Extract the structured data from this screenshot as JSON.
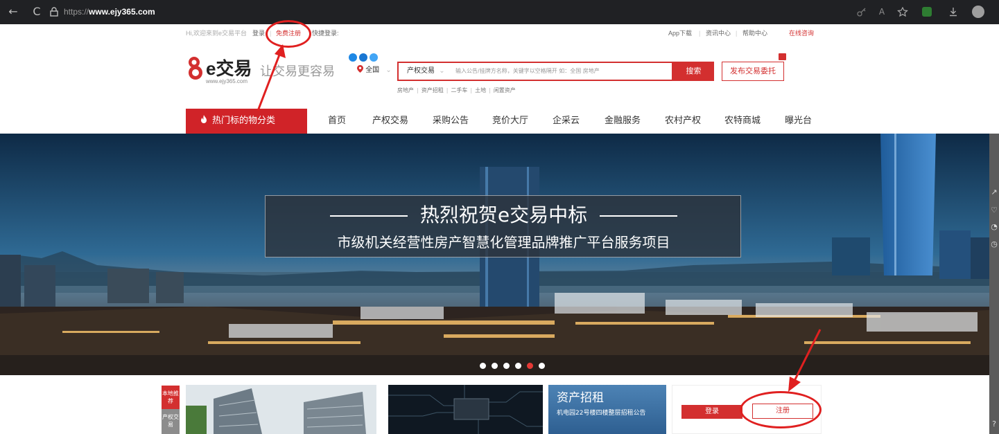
{
  "browser": {
    "url_prefix": "https://",
    "url_domain": "www.ejy365.com",
    "back_glyph": "←",
    "refresh_glyph": "C"
  },
  "topbar": {
    "welcome": "Hi,欢迎来到e交易平台",
    "login": "登录",
    "register": "免费注册",
    "quick_login": "快捷登录:",
    "app_download": "App下载",
    "news_center": "资讯中心",
    "help_center": "帮助中心",
    "online_consult": "在线咨询"
  },
  "header": {
    "logo_text": "e交易",
    "logo_url": "www.ejy365.com",
    "slogan": "让交易更容易",
    "region": "全国",
    "search_category": "产权交易",
    "search_placeholder": "输入公告/挂牌方名称，关键字以空格隔开 如：全国 房地产",
    "search_button": "搜索",
    "publish_button": "发布交易委托",
    "hotwords": [
      "房地产",
      "资产招租",
      "二手车",
      "土地",
      "闲置资产"
    ]
  },
  "nav": {
    "category_button": "热门标的物分类",
    "items": [
      "首页",
      "产权交易",
      "采购公告",
      "竞价大厅",
      "企采云",
      "金融服务",
      "农村产权",
      "农特商城",
      "曝光台"
    ]
  },
  "banner": {
    "title": "热烈祝贺e交易中标",
    "subtitle": "市级机关经营性房产智慧化管理品牌推广平台服务项目",
    "slide_count": 6,
    "active_slide": 5
  },
  "bottom": {
    "tag_local": "本地推荐",
    "tag_property": "产权交易",
    "asset_rent_title": "资产招租",
    "asset_rent_sub": "机电园22号楼四楼整层招租公告",
    "login_button": "登录",
    "register_button": "注册"
  },
  "colors": {
    "brand_red": "#d32f2f",
    "nav_red": "#d02328",
    "annotation_red": "#e02020"
  }
}
